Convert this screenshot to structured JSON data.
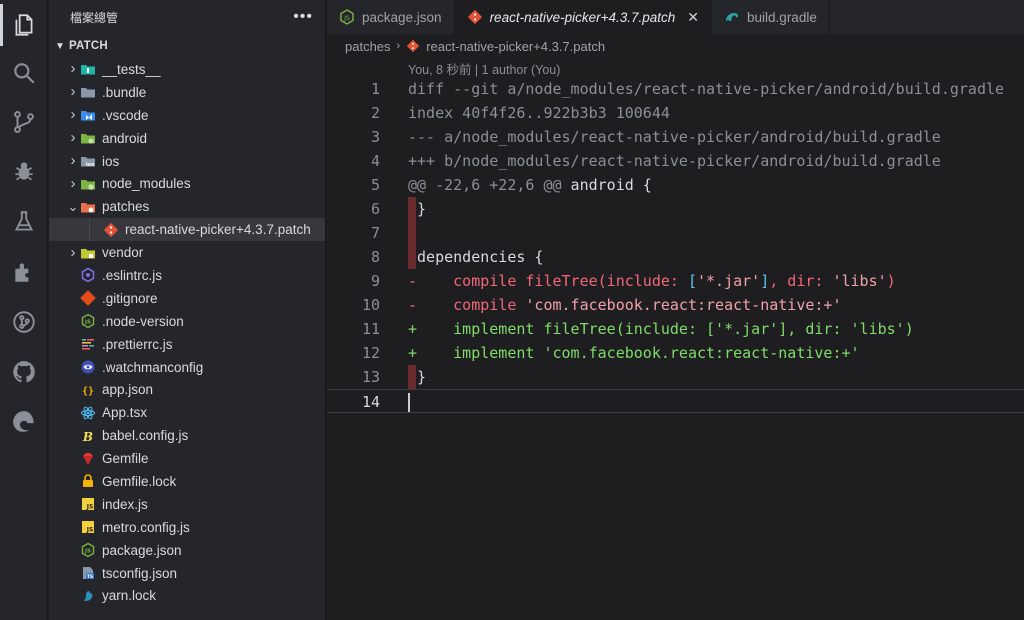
{
  "explorer": {
    "title": "檔案總管",
    "more_label": "•••",
    "section": "PATCH",
    "items": [
      {
        "label": "__tests__",
        "icon": "folder-test-icon",
        "expandable": true
      },
      {
        "label": ".bundle",
        "icon": "folder-icon",
        "expandable": true
      },
      {
        "label": ".vscode",
        "icon": "folder-vscode-icon",
        "expandable": true
      },
      {
        "label": "android",
        "icon": "folder-android-icon",
        "expandable": true
      },
      {
        "label": "ios",
        "icon": "folder-ios-icon",
        "expandable": true
      },
      {
        "label": "node_modules",
        "icon": "folder-node-icon",
        "expandable": true
      },
      {
        "label": "patches",
        "icon": "folder-patches-icon",
        "expandable": true,
        "expanded": true
      },
      {
        "label": "react-native-picker+4.3.7.patch",
        "icon": "patch-file-icon",
        "expandable": false,
        "selected": true,
        "indent": 1
      },
      {
        "label": "vendor",
        "icon": "folder-vendor-icon",
        "expandable": true
      },
      {
        "label": ".eslintrc.js",
        "icon": "eslint-file-icon",
        "expandable": false
      },
      {
        "label": ".gitignore",
        "icon": "git-file-icon",
        "expandable": false
      },
      {
        "label": ".node-version",
        "icon": "node-file-icon",
        "expandable": false
      },
      {
        "label": ".prettierrc.js",
        "icon": "prettier-file-icon",
        "expandable": false
      },
      {
        "label": ".watchmanconfig",
        "icon": "watchman-file-icon",
        "expandable": false
      },
      {
        "label": "app.json",
        "icon": "json-file-icon",
        "expandable": false
      },
      {
        "label": "App.tsx",
        "icon": "react-file-icon",
        "expandable": false
      },
      {
        "label": "babel.config.js",
        "icon": "babel-file-icon",
        "expandable": false
      },
      {
        "label": "Gemfile",
        "icon": "ruby-file-icon",
        "expandable": false
      },
      {
        "label": "Gemfile.lock",
        "icon": "lock-file-icon",
        "expandable": false
      },
      {
        "label": "index.js",
        "icon": "js-file-icon",
        "expandable": false
      },
      {
        "label": "metro.config.js",
        "icon": "js-file-icon",
        "expandable": false
      },
      {
        "label": "package.json",
        "icon": "npm-file-icon",
        "expandable": false
      },
      {
        "label": "tsconfig.json",
        "icon": "ts-file-icon",
        "expandable": false
      },
      {
        "label": "yarn.lock",
        "icon": "yarn-file-icon",
        "expandable": false
      }
    ]
  },
  "tabs": [
    {
      "label": "package.json",
      "icon": "npm-file-icon",
      "active": false
    },
    {
      "label": "react-native-picker+4.3.7.patch",
      "icon": "patch-file-icon",
      "active": true,
      "close": "✕"
    },
    {
      "label": "build.gradle",
      "icon": "gradle-file-icon",
      "active": false
    }
  ],
  "breadcrumb": {
    "folder": "patches",
    "file": "react-native-picker+4.3.7.patch"
  },
  "codelens": "You, 8 秒前 | 1 author (You)",
  "code": {
    "lines": [
      {
        "n": "1",
        "segs": [
          {
            "t": "diff --git a/node_modules/react-native-picker/android/build.gradle",
            "c": "c-meta"
          }
        ]
      },
      {
        "n": "2",
        "segs": [
          {
            "t": "index 40f4f26..922b3b3 100644",
            "c": "c-meta"
          }
        ]
      },
      {
        "n": "3",
        "segs": [
          {
            "t": "--- a/node_modules/react-native-picker/android/build.gradle",
            "c": "c-meta"
          }
        ]
      },
      {
        "n": "4",
        "segs": [
          {
            "t": "+++ b/node_modules/react-native-picker/android/build.gradle",
            "c": "c-meta"
          }
        ]
      },
      {
        "n": "5",
        "segs": [
          {
            "t": "@@ -22,6 +22,6 @@",
            "c": "c-meta"
          },
          {
            "t": " android {",
            "c": "c-plain"
          }
        ]
      },
      {
        "n": "6",
        "marker": true,
        "segs": [
          {
            "t": " }",
            "c": "c-plain"
          }
        ]
      },
      {
        "n": "7",
        "marker": true,
        "segs": [
          {
            "t": "",
            "c": "c-plain"
          }
        ]
      },
      {
        "n": "8",
        "marker": true,
        "segs": [
          {
            "t": " dependencies {",
            "c": "c-plain"
          }
        ]
      },
      {
        "n": "9",
        "segs": [
          {
            "t": "-    compile fileTree(include: ",
            "c": "c-del"
          },
          {
            "t": "[",
            "c": "c-br-del"
          },
          {
            "t": "'*.jar'",
            "c": "c-str-del"
          },
          {
            "t": "]",
            "c": "c-br-del"
          },
          {
            "t": ", dir: ",
            "c": "c-del"
          },
          {
            "t": "'libs'",
            "c": "c-str-del"
          },
          {
            "t": ")",
            "c": "c-del"
          }
        ]
      },
      {
        "n": "10",
        "segs": [
          {
            "t": "-    compile ",
            "c": "c-del"
          },
          {
            "t": "'com.facebook.react:react-native:+'",
            "c": "c-str-del"
          }
        ]
      },
      {
        "n": "11",
        "segs": [
          {
            "t": "+    implement fileTree(include: [",
            "c": "c-add"
          },
          {
            "t": "'*.jar'",
            "c": "c-add"
          },
          {
            "t": "], dir: ",
            "c": "c-add"
          },
          {
            "t": "'libs'",
            "c": "c-add"
          },
          {
            "t": ")",
            "c": "c-add"
          }
        ]
      },
      {
        "n": "12",
        "segs": [
          {
            "t": "+    implement ",
            "c": "c-add"
          },
          {
            "t": "'com.facebook.react:react-native:+'",
            "c": "c-add"
          }
        ]
      },
      {
        "n": "13",
        "marker": true,
        "segs": [
          {
            "t": " }",
            "c": "c-plain"
          }
        ]
      },
      {
        "n": "14",
        "current": true,
        "segs": [
          {
            "t": "",
            "c": "c-plain"
          }
        ]
      }
    ]
  },
  "colors": {
    "accent_marker": "#6b2a2e",
    "deleted": "#f2667a",
    "added": "#7fdc6a"
  }
}
